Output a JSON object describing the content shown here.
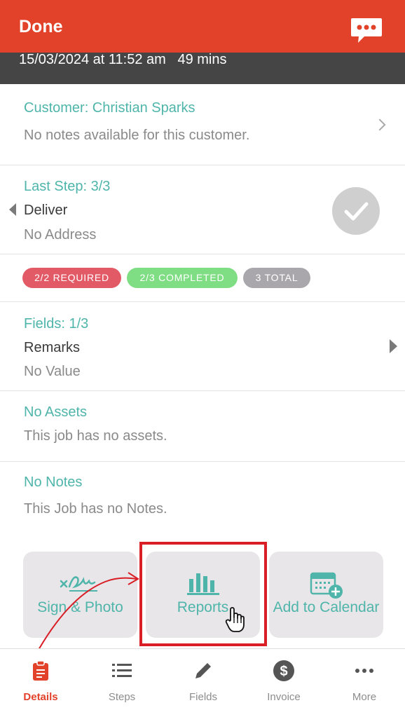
{
  "header": {
    "title": "Done",
    "chat_icon": "chat-bubble-icon",
    "color": "#e2412a"
  },
  "job": {
    "datetime": "15/03/2024 at 11:52 am   49 mins"
  },
  "customer": {
    "label": "Customer: Christian Sparks",
    "notes": "No notes available for this customer."
  },
  "step": {
    "label": "Last Step: 3/3",
    "name": "Deliver",
    "address": "No Address"
  },
  "badges": [
    {
      "text": "2/2 REQUIRED",
      "color": "#e35a67"
    },
    {
      "text": "2/3 COMPLETED",
      "color": "#7fdd84"
    },
    {
      "text": "3 TOTAL",
      "color": "#a9a7ab"
    }
  ],
  "fields": {
    "label": "Fields: 1/3",
    "name": "Remarks",
    "value": "No Value"
  },
  "assets": {
    "label": "No Assets",
    "text": "This job has no assets."
  },
  "notes": {
    "label": "No Notes",
    "text": "This Job has no Notes."
  },
  "actions": [
    {
      "label": "Sign & Photo",
      "icon": "signature-icon"
    },
    {
      "label": "Reports",
      "icon": "bar-chart-icon"
    },
    {
      "label": "Add to Calendar",
      "icon": "calendar-add-icon"
    }
  ],
  "tabs": [
    {
      "label": "Details",
      "icon": "clipboard-icon",
      "active": true
    },
    {
      "label": "Steps",
      "icon": "list-icon"
    },
    {
      "label": "Fields",
      "icon": "pencil-icon"
    },
    {
      "label": "Invoice",
      "icon": "dollar-icon"
    },
    {
      "label": "More",
      "icon": "more-dots-icon"
    }
  ]
}
